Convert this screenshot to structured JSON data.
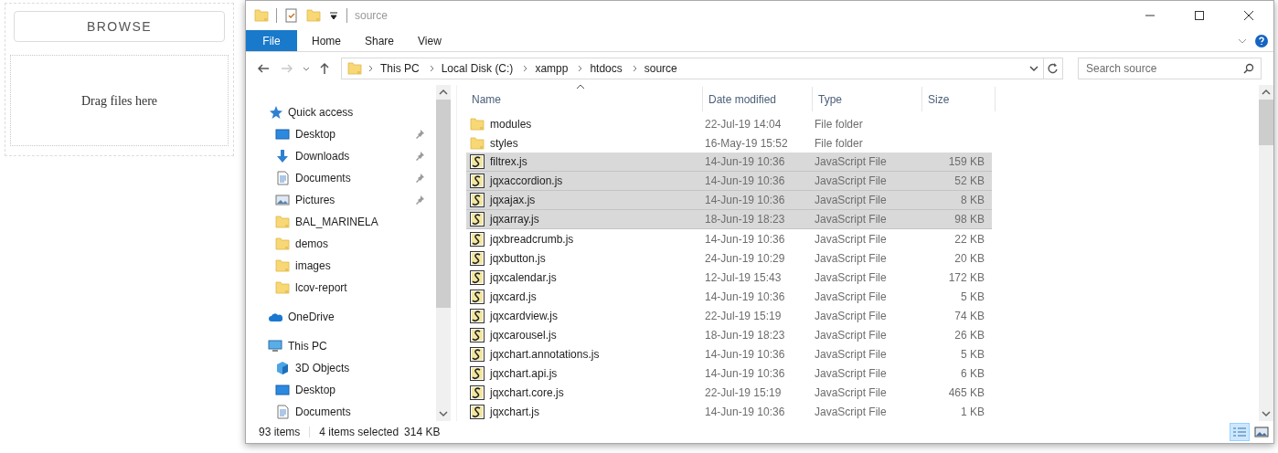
{
  "uploader": {
    "browse_button": "BROWSE",
    "drop_zone": "Drag files here"
  },
  "window": {
    "title": "source"
  },
  "ribbon": {
    "tabs": [
      {
        "label": "File",
        "selected": true
      },
      {
        "label": "Home",
        "selected": false
      },
      {
        "label": "Share",
        "selected": false
      },
      {
        "label": "View",
        "selected": false
      }
    ]
  },
  "address_bar": {
    "path": [
      "This PC",
      "Local Disk (C:)",
      "xampp",
      "htdocs",
      "source"
    ]
  },
  "search": {
    "placeholder": "Search source"
  },
  "nav": [
    {
      "label": "Quick access",
      "kind": "quick",
      "children": [
        {
          "label": "Desktop",
          "kind": "desktop",
          "pinned": true
        },
        {
          "label": "Downloads",
          "kind": "downloads",
          "pinned": true
        },
        {
          "label": "Documents",
          "kind": "documents",
          "pinned": true
        },
        {
          "label": "Pictures",
          "kind": "pictures",
          "pinned": true
        },
        {
          "label": "BAL_MARINELA",
          "kind": "folder",
          "pinned": false
        },
        {
          "label": "demos",
          "kind": "folder",
          "pinned": false
        },
        {
          "label": "images",
          "kind": "folder",
          "pinned": false
        },
        {
          "label": "lcov-report",
          "kind": "folder",
          "pinned": false
        }
      ]
    },
    {
      "label": "OneDrive",
      "kind": "onedrive"
    },
    {
      "label": "This PC",
      "kind": "thispc",
      "children": [
        {
          "label": "3D Objects",
          "kind": "objects3d"
        },
        {
          "label": "Desktop",
          "kind": "desktop"
        },
        {
          "label": "Documents",
          "kind": "documents"
        }
      ]
    }
  ],
  "columns": [
    "Name",
    "Date modified",
    "Type",
    "Size"
  ],
  "files": [
    {
      "name": "modules",
      "date": "22-Jul-19 14:04",
      "type": "File folder",
      "kind": "folder",
      "selected": false
    },
    {
      "name": "styles",
      "date": "16-May-19 15:52",
      "type": "File folder",
      "kind": "folder",
      "selected": false
    },
    {
      "name": "filtrex.js",
      "date": "14-Jun-19 10:36",
      "type": "JavaScript File",
      "size": "159 KB",
      "kind": "js",
      "selected": true
    },
    {
      "name": "jqxaccordion.js",
      "date": "14-Jun-19 10:36",
      "type": "JavaScript File",
      "size": "52 KB",
      "kind": "js",
      "selected": true
    },
    {
      "name": "jqxajax.js",
      "date": "14-Jun-19 10:36",
      "type": "JavaScript File",
      "size": "8 KB",
      "kind": "js",
      "selected": true
    },
    {
      "name": "jqxarray.js",
      "date": "18-Jun-19 18:23",
      "type": "JavaScript File",
      "size": "98 KB",
      "kind": "js",
      "selected": true
    },
    {
      "name": "jqxbreadcrumb.js",
      "date": "14-Jun-19 10:36",
      "type": "JavaScript File",
      "size": "22 KB",
      "kind": "js",
      "selected": false
    },
    {
      "name": "jqxbutton.js",
      "date": "24-Jun-19 10:29",
      "type": "JavaScript File",
      "size": "20 KB",
      "kind": "js",
      "selected": false
    },
    {
      "name": "jqxcalendar.js",
      "date": "12-Jul-19 15:43",
      "type": "JavaScript File",
      "size": "172 KB",
      "kind": "js",
      "selected": false
    },
    {
      "name": "jqxcard.js",
      "date": "14-Jun-19 10:36",
      "type": "JavaScript File",
      "size": "5 KB",
      "kind": "js",
      "selected": false
    },
    {
      "name": "jqxcardview.js",
      "date": "22-Jul-19 15:19",
      "type": "JavaScript File",
      "size": "74 KB",
      "kind": "js",
      "selected": false
    },
    {
      "name": "jqxcarousel.js",
      "date": "18-Jun-19 18:23",
      "type": "JavaScript File",
      "size": "26 KB",
      "kind": "js",
      "selected": false
    },
    {
      "name": "jqxchart.annotations.js",
      "date": "14-Jun-19 10:36",
      "type": "JavaScript File",
      "size": "5 KB",
      "kind": "js",
      "selected": false
    },
    {
      "name": "jqxchart.api.js",
      "date": "14-Jun-19 10:36",
      "type": "JavaScript File",
      "size": "6 KB",
      "kind": "js",
      "selected": false
    },
    {
      "name": "jqxchart.core.js",
      "date": "22-Jul-19 15:19",
      "type": "JavaScript File",
      "size": "465 KB",
      "kind": "js",
      "selected": false
    },
    {
      "name": "jqxchart.js",
      "date": "14-Jun-19 10:36",
      "type": "JavaScript File",
      "size": "1 KB",
      "kind": "js",
      "selected": false
    }
  ],
  "status_bar": {
    "item_count": "93 items",
    "selection": "4 items selected",
    "selection_size": "314 KB"
  },
  "view_buttons": [
    {
      "kind": "details",
      "selected": true
    },
    {
      "kind": "large-icons",
      "selected": false
    }
  ]
}
